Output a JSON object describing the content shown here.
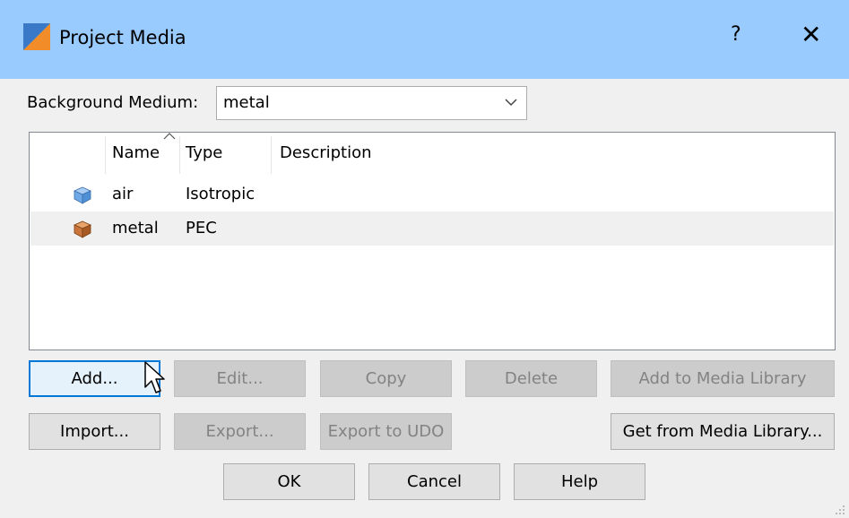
{
  "window": {
    "title": "Project Media",
    "help_icon": "question-mark-icon",
    "close_icon": "close-icon"
  },
  "background": {
    "label": "Background Medium:",
    "value": "metal"
  },
  "table": {
    "columns": [
      "Name",
      "Type",
      "Description"
    ],
    "sorted_by": "Name",
    "rows": [
      {
        "icon": "cube-icon",
        "icon_color": "#6fa8e6",
        "name": "air",
        "type": "Isotropic",
        "description": ""
      },
      {
        "icon": "cube-icon",
        "icon_color": "#c8743a",
        "name": "metal",
        "type": "PEC",
        "description": ""
      }
    ]
  },
  "buttons": {
    "add": "Add...",
    "edit": "Edit...",
    "copy": "Copy",
    "delete": "Delete",
    "add_to_library": "Add to Media Library",
    "import": "Import...",
    "export": "Export...",
    "export_udo": "Export to UDO",
    "get_from_library": "Get from Media Library...",
    "ok": "OK",
    "cancel": "Cancel",
    "help": "Help"
  },
  "colors": {
    "titlebar": "#99cbff",
    "focus_border": "#0078d7",
    "air_cube": "#6fa8e6",
    "metal_cube": "#c8743a"
  }
}
